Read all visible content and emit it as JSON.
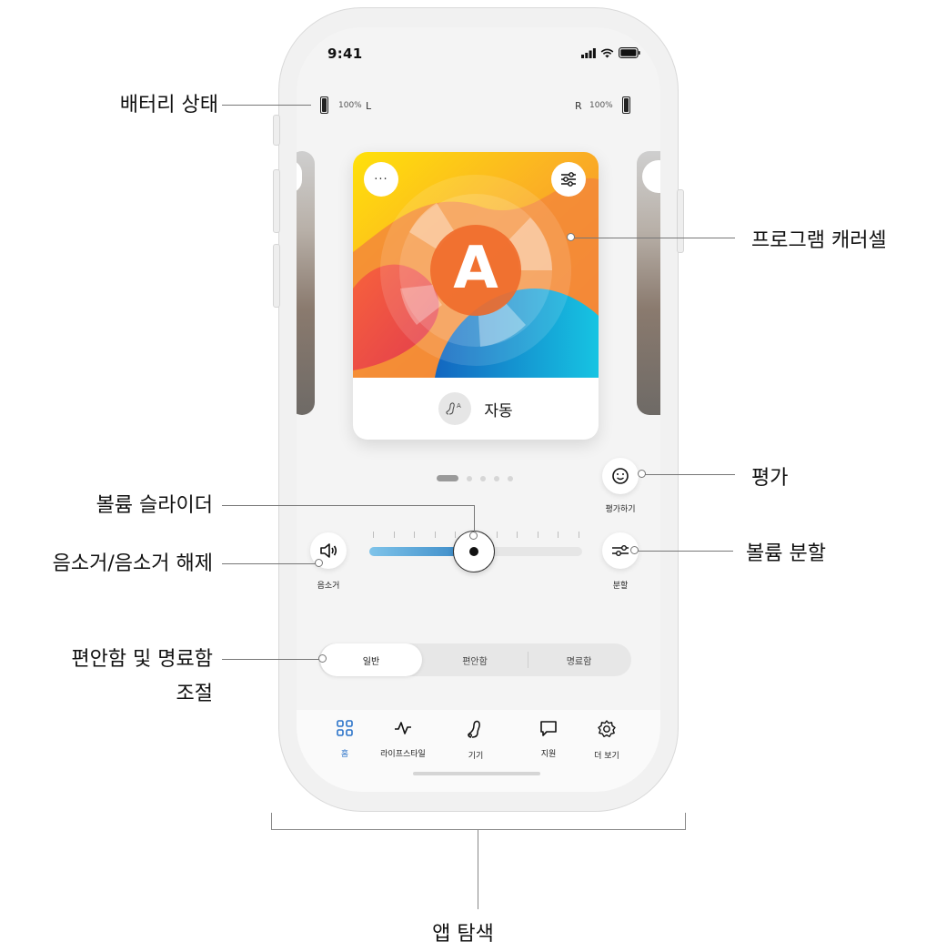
{
  "status_bar": {
    "time": "9:41"
  },
  "battery": {
    "left_percent": "100%",
    "left_side": "L",
    "right_side": "R",
    "right_percent": "100%"
  },
  "program_card": {
    "more_icon": "more-dots-icon",
    "settings_icon": "sliders-icon",
    "letter": "A",
    "program_icon": "hearing-aid-auto-icon",
    "name": "자동"
  },
  "carousel": {
    "page_count": 5,
    "active_page": 1
  },
  "rating_button": {
    "label": "평가하기",
    "icon": "smiley-icon"
  },
  "mute_button": {
    "label": "음소거",
    "icon": "speaker-icon"
  },
  "split_button": {
    "label": "분할",
    "icon": "split-sliders-icon"
  },
  "volume": {
    "level": 0.49
  },
  "sound_mode": {
    "options": [
      "일반",
      "편안함",
      "명료함"
    ],
    "selected": "일반"
  },
  "tab_bar": {
    "active": "홈",
    "tabs": [
      {
        "label": "홈",
        "icon": "grid-icon"
      },
      {
        "label": "라이프스타일",
        "icon": "activity-icon"
      },
      {
        "label": "기기",
        "icon": "hearing-aid-icon"
      },
      {
        "label": "지원",
        "icon": "chat-bubble-icon"
      },
      {
        "label": "더 보기",
        "icon": "gear-icon"
      }
    ]
  },
  "callouts": {
    "battery_status": "배터리 상태",
    "program_carousel": "프로그램 캐러셀",
    "rating": "평가",
    "volume_slider": "볼륨 슬라이더",
    "mute_unmute": "음소거/음소거 해제",
    "volume_split": "볼륨 분할",
    "comfort_clarity_line1": "편안함 및 명료함",
    "comfort_clarity_line2": "조절",
    "app_navigation": "앱 탐색"
  },
  "colors": {
    "accent_blue": "#2a73c9",
    "slider_fill_start": "#7fc4ea",
    "slider_fill_end": "#2e7fc0",
    "card_gradient_warm": "#f08a2c",
    "card_gradient_cool": "#19b6dd"
  }
}
